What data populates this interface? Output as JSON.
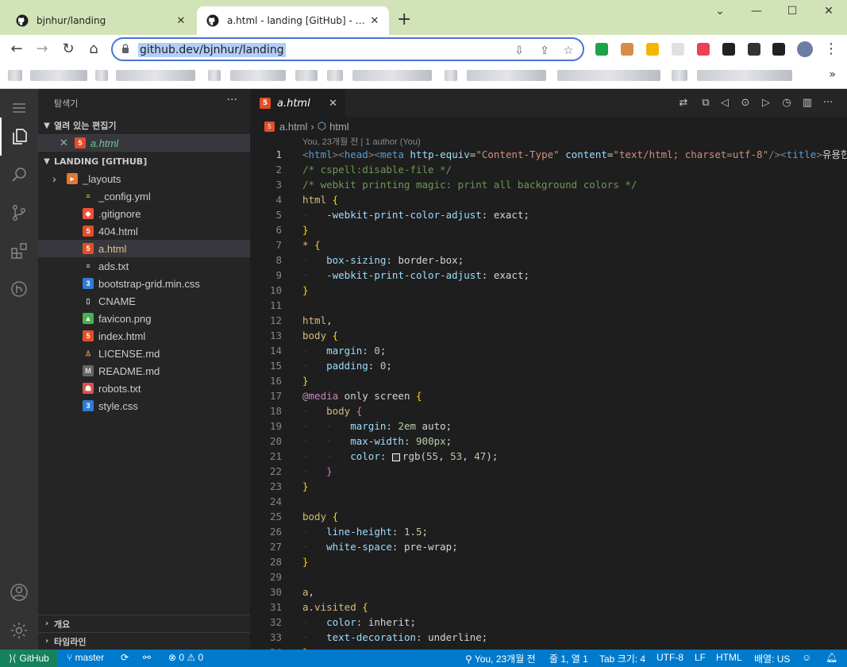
{
  "browser": {
    "tabs": [
      {
        "title": "bjnhur/landing"
      },
      {
        "title": "a.html - landing [GitHub] - Visual Studio Code"
      }
    ],
    "new_tab": "+",
    "url": "github.dev/bjnhur/landing",
    "bookmarks_more": "»"
  },
  "vscode": {
    "sidebar": {
      "title": "탐색기",
      "more": "···",
      "open_editors_header": "열려 있는 편집기",
      "open_editor": {
        "close": "✕",
        "name": "a.html"
      },
      "repo_header": "LANDING [GITHUB]",
      "files": [
        {
          "name": "_layouts",
          "kind": "folder"
        },
        {
          "name": "_config.yml",
          "kind": "yml"
        },
        {
          "name": ".gitignore",
          "kind": "git"
        },
        {
          "name": "404.html",
          "kind": "html"
        },
        {
          "name": "a.html",
          "kind": "html",
          "selected": true
        },
        {
          "name": "ads.txt",
          "kind": "txt"
        },
        {
          "name": "bootstrap-grid.min.css",
          "kind": "css"
        },
        {
          "name": "CNAME",
          "kind": "file"
        },
        {
          "name": "favicon.png",
          "kind": "png"
        },
        {
          "name": "index.html",
          "kind": "html"
        },
        {
          "name": "LICENSE.md",
          "kind": "license"
        },
        {
          "name": "README.md",
          "kind": "md"
        },
        {
          "name": "robots.txt",
          "kind": "robots"
        },
        {
          "name": "style.css",
          "kind": "css"
        }
      ],
      "outline_header": "개요",
      "timeline_header": "타임라인"
    },
    "editor": {
      "tab_label": "a.html",
      "tab_close": "✕",
      "breadcrumb": [
        "a.html",
        "html"
      ],
      "blame": "You, 23개월 전 | 1 author (You)"
    },
    "statusbar": {
      "remote": "GitHub",
      "branch": "master",
      "sync": "⟳",
      "errors": "0",
      "warnings": "0",
      "blame": "You, 23개월 전",
      "position": "줄 1, 열 1",
      "tab_size": "Tab 크기: 4",
      "encoding": "UTF-8",
      "eol": "LF",
      "language": "HTML",
      "layout": "배열: US"
    }
  },
  "code_lines": [
    [
      [
        "t-pun",
        "<"
      ],
      [
        "t-tag",
        "html"
      ],
      [
        "t-pun",
        "><"
      ],
      [
        "t-tag",
        "head"
      ],
      [
        "t-pun",
        "><"
      ],
      [
        "t-tag",
        "meta"
      ],
      [
        "t-plain",
        " "
      ],
      [
        "t-attr",
        "http-equiv"
      ],
      [
        "t-plain",
        "="
      ],
      [
        "t-str",
        "\"Content-Type\""
      ],
      [
        "t-plain",
        " "
      ],
      [
        "t-attr",
        "content"
      ],
      [
        "t-plain",
        "="
      ],
      [
        "t-str",
        "\"text/html; charset=utf-8\""
      ],
      [
        "t-pun",
        "/><"
      ],
      [
        "t-tag",
        "title"
      ],
      [
        "t-pun",
        ">"
      ],
      [
        "t-txt",
        "유용한 정보"
      ]
    ],
    [
      [
        "t-com",
        "/* cspell:disable-file */"
      ]
    ],
    [
      [
        "t-com",
        "/* webkit printing magic: print all background colors */"
      ]
    ],
    [
      [
        "t-sel",
        "html"
      ],
      [
        "t-plain",
        " "
      ],
      [
        "t-br1",
        "{"
      ]
    ],
    [
      [
        "guide",
        "·   "
      ],
      [
        "t-prop",
        "-webkit-print-color-adjust"
      ],
      [
        "t-plain",
        ": "
      ],
      [
        "t-plain",
        "exact"
      ],
      [
        "t-plain",
        ";"
      ]
    ],
    [
      [
        "t-br1",
        "}"
      ]
    ],
    [
      [
        "t-sel",
        "*"
      ],
      [
        "t-plain",
        " "
      ],
      [
        "t-br1",
        "{"
      ]
    ],
    [
      [
        "guide",
        "·   "
      ],
      [
        "t-prop",
        "box-sizing"
      ],
      [
        "t-plain",
        ": "
      ],
      [
        "t-plain",
        "border-box"
      ],
      [
        "t-plain",
        ";"
      ]
    ],
    [
      [
        "guide",
        "·   "
      ],
      [
        "t-prop",
        "-webkit-print-color-adjust"
      ],
      [
        "t-plain",
        ": "
      ],
      [
        "t-plain",
        "exact"
      ],
      [
        "t-plain",
        ";"
      ]
    ],
    [
      [
        "t-br1",
        "}"
      ]
    ],
    [],
    [
      [
        "t-sel",
        "html"
      ],
      [
        "t-plain",
        ","
      ]
    ],
    [
      [
        "t-sel",
        "body"
      ],
      [
        "t-plain",
        " "
      ],
      [
        "t-br1",
        "{"
      ]
    ],
    [
      [
        "guide",
        "·   "
      ],
      [
        "t-prop",
        "margin"
      ],
      [
        "t-plain",
        ": "
      ],
      [
        "t-num",
        "0"
      ],
      [
        "t-plain",
        ";"
      ]
    ],
    [
      [
        "guide",
        "·   "
      ],
      [
        "t-prop",
        "padding"
      ],
      [
        "t-plain",
        ": "
      ],
      [
        "t-num",
        "0"
      ],
      [
        "t-plain",
        ";"
      ]
    ],
    [
      [
        "t-br1",
        "}"
      ]
    ],
    [
      [
        "t-kw",
        "@media"
      ],
      [
        "t-plain",
        " only screen "
      ],
      [
        "t-br1",
        "{"
      ]
    ],
    [
      [
        "guide",
        "·   "
      ],
      [
        "t-sel",
        "body"
      ],
      [
        "t-plain",
        " "
      ],
      [
        "t-br2",
        "{"
      ]
    ],
    [
      [
        "guide",
        "·   ·   "
      ],
      [
        "t-prop",
        "margin"
      ],
      [
        "t-plain",
        ": "
      ],
      [
        "t-num",
        "2em"
      ],
      [
        "t-plain",
        " auto;"
      ]
    ],
    [
      [
        "guide",
        "·   ·   "
      ],
      [
        "t-prop",
        "max-width"
      ],
      [
        "t-plain",
        ": "
      ],
      [
        "t-num",
        "900px"
      ],
      [
        "t-plain",
        ";"
      ]
    ],
    [
      [
        "guide",
        "·   ·   "
      ],
      [
        "t-prop",
        "color"
      ],
      [
        "t-plain",
        ": "
      ],
      [
        "swatch",
        ""
      ],
      [
        "t-plain",
        "rgb("
      ],
      [
        "t-num",
        "55"
      ],
      [
        "t-plain",
        ", "
      ],
      [
        "t-num",
        "53"
      ],
      [
        "t-plain",
        ", "
      ],
      [
        "t-num",
        "47"
      ],
      [
        "t-plain",
        ");"
      ]
    ],
    [
      [
        "guide",
        "·   "
      ],
      [
        "t-br2",
        "}"
      ]
    ],
    [
      [
        "t-br1",
        "}"
      ]
    ],
    [],
    [
      [
        "t-sel",
        "body"
      ],
      [
        "t-plain",
        " "
      ],
      [
        "t-br1",
        "{"
      ]
    ],
    [
      [
        "guide",
        "·   "
      ],
      [
        "t-prop",
        "line-height"
      ],
      [
        "t-plain",
        ": "
      ],
      [
        "t-num",
        "1.5"
      ],
      [
        "t-plain",
        ";"
      ]
    ],
    [
      [
        "guide",
        "·   "
      ],
      [
        "t-prop",
        "white-space"
      ],
      [
        "t-plain",
        ": "
      ],
      [
        "t-plain",
        "pre-wrap"
      ],
      [
        "t-plain",
        ";"
      ]
    ],
    [
      [
        "t-br1",
        "}"
      ]
    ],
    [],
    [
      [
        "t-sel",
        "a"
      ],
      [
        "t-plain",
        ","
      ]
    ],
    [
      [
        "t-sel",
        "a.visited"
      ],
      [
        "t-plain",
        " "
      ],
      [
        "t-br1",
        "{"
      ]
    ],
    [
      [
        "guide",
        "·   "
      ],
      [
        "t-prop",
        "color"
      ],
      [
        "t-plain",
        ": "
      ],
      [
        "t-plain",
        "inherit"
      ],
      [
        "t-plain",
        ";"
      ]
    ],
    [
      [
        "guide",
        "·   "
      ],
      [
        "t-prop",
        "text-decoration"
      ],
      [
        "t-plain",
        ": "
      ],
      [
        "t-plain",
        "underline"
      ],
      [
        "t-plain",
        ";"
      ]
    ],
    [
      [
        "t-br1",
        "}"
      ]
    ]
  ],
  "line_numbers": [
    "1",
    "2",
    "3",
    "4",
    "5",
    "6",
    "7",
    "8",
    "9",
    "10",
    "11",
    "12",
    "13",
    "14",
    "15",
    "16",
    "17",
    "18",
    "19",
    "20",
    "21",
    "22",
    "23",
    "24",
    "25",
    "26",
    "27",
    "28",
    "29",
    "30",
    "31",
    "32",
    "33",
    "34"
  ],
  "colors": {
    "statusbar": "#007acc",
    "remote": "#16825d",
    "sidebar": "#252526",
    "editor": "#1e1e1e",
    "tabstrip": "#d3e3b8"
  }
}
